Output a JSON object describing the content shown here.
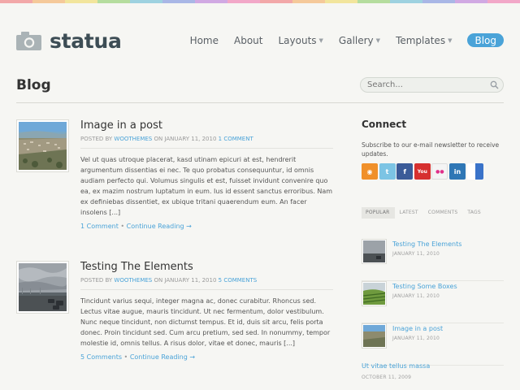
{
  "brand": {
    "name": "statua",
    "icon": "camera-icon"
  },
  "rainbow": [
    "#f2a8a8",
    "#f5c99a",
    "#f2e59c",
    "#b5dd9e",
    "#9ed2e0",
    "#a9b7e6",
    "#d1a9e3",
    "#f2a8c8",
    "#f2a8a8",
    "#f5c99a",
    "#f2e59c",
    "#b5dd9e",
    "#9ed2e0",
    "#a9b7e6",
    "#d1a9e3",
    "#f2a8c8"
  ],
  "nav": [
    {
      "label": "Home",
      "dropdown": false
    },
    {
      "label": "About",
      "dropdown": false
    },
    {
      "label": "Layouts",
      "dropdown": true
    },
    {
      "label": "Gallery",
      "dropdown": true
    },
    {
      "label": "Templates",
      "dropdown": true
    },
    {
      "label": "Blog",
      "dropdown": false,
      "active": true
    }
  ],
  "page": {
    "title": "Blog"
  },
  "search": {
    "placeholder": "Search..."
  },
  "posts": [
    {
      "title": "Image in a post",
      "meta_prefix": "POSTED BY",
      "author": "WOOTHEMES",
      "date_text": "ON JANUARY 11, 2010",
      "comments_link": "1 COMMENT",
      "excerpt": "Vel ut quas utroque placerat, kasd utinam epicuri at est, hendrerit argumentum dissentias ei nec. Te quo probatus consequuntur, id omnis audiam perfecto qui. Volumus singulis et est, fuisset invidunt convenire quo ea, ex mazim nostrum luptatum in eum. Ius id essent sanctus erroribus. Nam ex definiebas dissentiet, ex ubique tritani quaerendum eum. An facer insolens [...]",
      "comments_footer": "1 Comment",
      "continue": "Continue Reading →"
    },
    {
      "title": "Testing The Elements",
      "meta_prefix": "POSTED BY",
      "author": "WOOTHEMES",
      "date_text": "ON JANUARY 11, 2010",
      "comments_link": "5 COMMENTS",
      "excerpt": "Tincidunt varius sequi, integer magna ac, donec curabitur. Rhoncus sed. Lectus vitae augue, mauris tincidunt. Ut nec fermentum, dolor vestibulum. Nunc neque tincidunt, non dictumst tempus. Et id, duis sit arcu, felis porta donec. Proin tincidunt sed. Cum arcu pretium, sed sed. In nonummy, tempor molestie id, omnis tellus. A risus dolor, vitae et donec, mauris [...]",
      "comments_footer": "5 Comments",
      "continue": "Continue Reading →"
    }
  ],
  "sidebar": {
    "connect_title": "Connect",
    "connect_desc": "Subscribe to our e-mail newsletter to receive updates.",
    "social": [
      {
        "name": "rss-icon",
        "color": "#f0902a",
        "glyph": "◉"
      },
      {
        "name": "twitter-icon",
        "color": "#7cc4e4",
        "glyph": "t"
      },
      {
        "name": "facebook-icon",
        "color": "#3b5b98",
        "glyph": "f"
      },
      {
        "name": "youtube-icon",
        "color": "#d6302f",
        "glyph": "You"
      },
      {
        "name": "flickr-icon",
        "color": "#f4f4f4",
        "glyph": "●●"
      },
      {
        "name": "linkedin-icon",
        "color": "#2f77b5",
        "glyph": "in"
      },
      {
        "name": "delicious-icon",
        "color": "#3a73c9",
        "glyph": ""
      }
    ],
    "tabs": [
      "POPULAR",
      "LATEST",
      "COMMENTS",
      "TAGS"
    ],
    "popular": [
      {
        "title": "Testing The Elements",
        "date": "JANUARY 11, 2010"
      },
      {
        "title": "Testing Some Boxes",
        "date": "JANUARY 11, 2010"
      },
      {
        "title": "Image in a post",
        "date": "JANUARY 11, 2010"
      },
      {
        "title": "Ut vitae tellus massa",
        "date": "OCTOBER 11, 2009"
      }
    ]
  }
}
